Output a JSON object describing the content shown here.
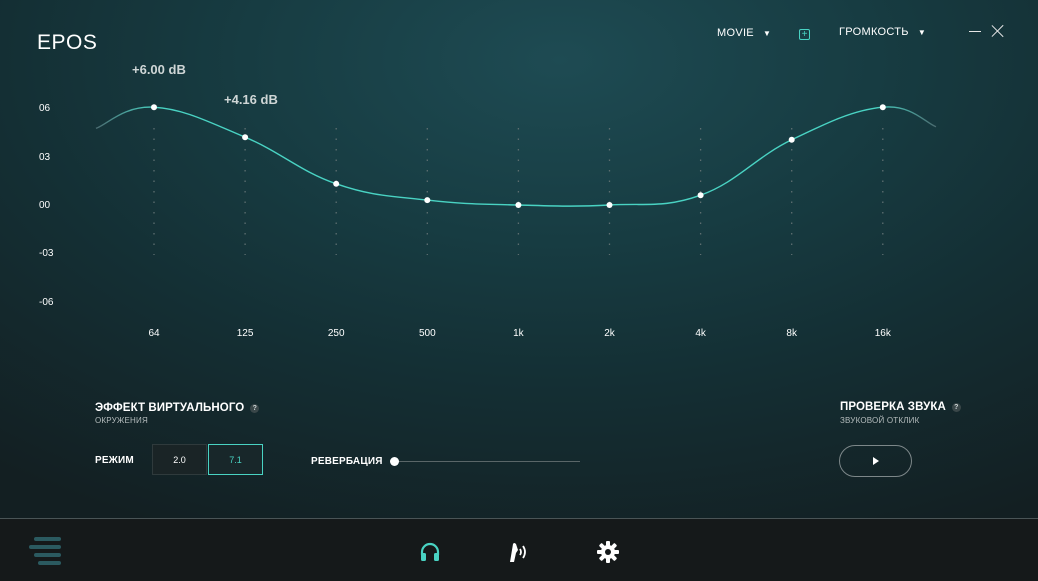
{
  "header": {
    "logo_text": "EPOS",
    "preset_label": "MOVIE",
    "volume_label": "ГРОМКОСТЬ",
    "plus_glyph": "+",
    "caret_glyph": "▼"
  },
  "equalizer": {
    "y_labels": [
      "06",
      "03",
      "00",
      "-03",
      "-06"
    ],
    "bands": [
      {
        "label": "64",
        "gain_db": 6.0
      },
      {
        "label": "125",
        "gain_db": 4.16
      },
      {
        "label": "250",
        "gain_db": 1.3
      },
      {
        "label": "500",
        "gain_db": 0.3
      },
      {
        "label": "1k",
        "gain_db": 0.0
      },
      {
        "label": "2k",
        "gain_db": 0.0
      },
      {
        "label": "4k",
        "gain_db": 0.6
      },
      {
        "label": "8k",
        "gain_db": 4.0
      },
      {
        "label": "16k",
        "gain_db": 6.0
      }
    ],
    "y_range_db": [
      -6,
      6
    ],
    "db_readouts": [
      "+6.00 dB",
      "+4.16 dB"
    ],
    "accent_color": "#49d3c3"
  },
  "surround": {
    "title": "ЭФФЕКТ ВИРТУАЛЬНОГО",
    "subtitle": "ОКРУЖЕНИЯ",
    "help_glyph": "?",
    "mode_label": "РЕЖИМ",
    "modes": [
      "2.0",
      "7.1"
    ],
    "active_mode": "7.1",
    "reverb_label": "РЕВЕРБАЦИЯ",
    "reverb_level": 0
  },
  "sound_test": {
    "title": "ПРОВЕРКА ЗВУКА",
    "subtitle": "ЗВУКОВОЙ ОТКЛИК",
    "help_glyph": "?"
  },
  "nav": {
    "items": [
      "menu-icon",
      "headphones-icon",
      "microphone-icon",
      "gear-icon"
    ],
    "active": "headphones-icon"
  }
}
